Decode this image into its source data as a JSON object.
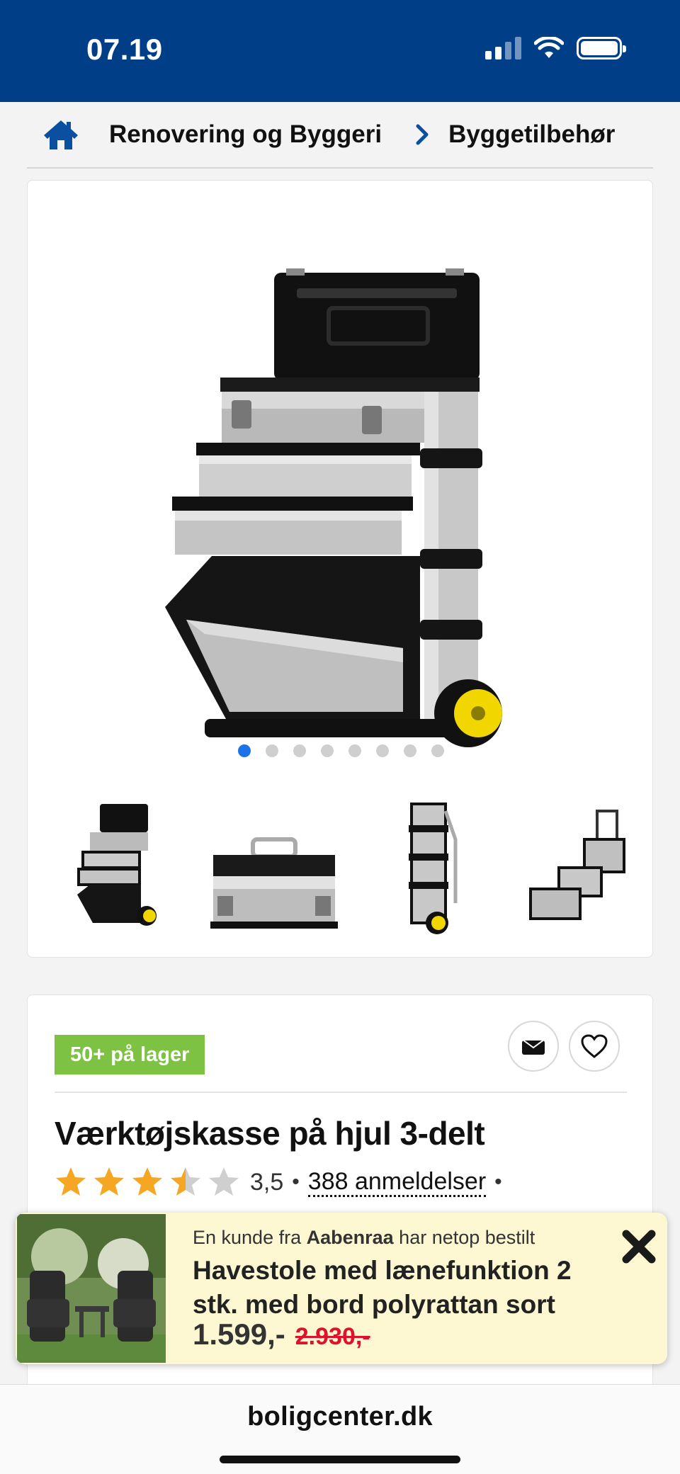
{
  "status_bar": {
    "time": "07.19",
    "background_color": "#003f87",
    "icons": [
      "signal-icon",
      "wifi-icon",
      "battery-icon"
    ]
  },
  "breadcrumb": {
    "home_icon": "home-icon",
    "items": [
      "Renovering og Byggeri",
      "Byggetilbehør"
    ]
  },
  "gallery": {
    "image_count": 8,
    "active_index": 0,
    "thumbnail_count": 4
  },
  "product": {
    "stock_badge": "50+ på lager",
    "stock_color": "#7dc243",
    "title": "Værktøjskasse på hjul 3-delt",
    "rating": "3,5",
    "rating_stars_value": 3.5,
    "rating_max": 5,
    "separator": "•",
    "reviews_label": "388 anmeldelser",
    "star_color": "#f5a623",
    "buttons": {
      "mail_icon": "envelope-icon",
      "favorite_icon": "heart-icon"
    }
  },
  "toast": {
    "prefix": "En kunde fra ",
    "city": "Aabenraa",
    "suffix": " har netop bestilt",
    "product_title": "Havestole med lænefunktion 2 stk. med bord polyrattan sort",
    "price": "1.599,-",
    "old_price": "2.930,-",
    "old_price_color": "#e0112b",
    "close_icon": "close-icon"
  },
  "browser": {
    "url": "boligcenter.dk"
  }
}
